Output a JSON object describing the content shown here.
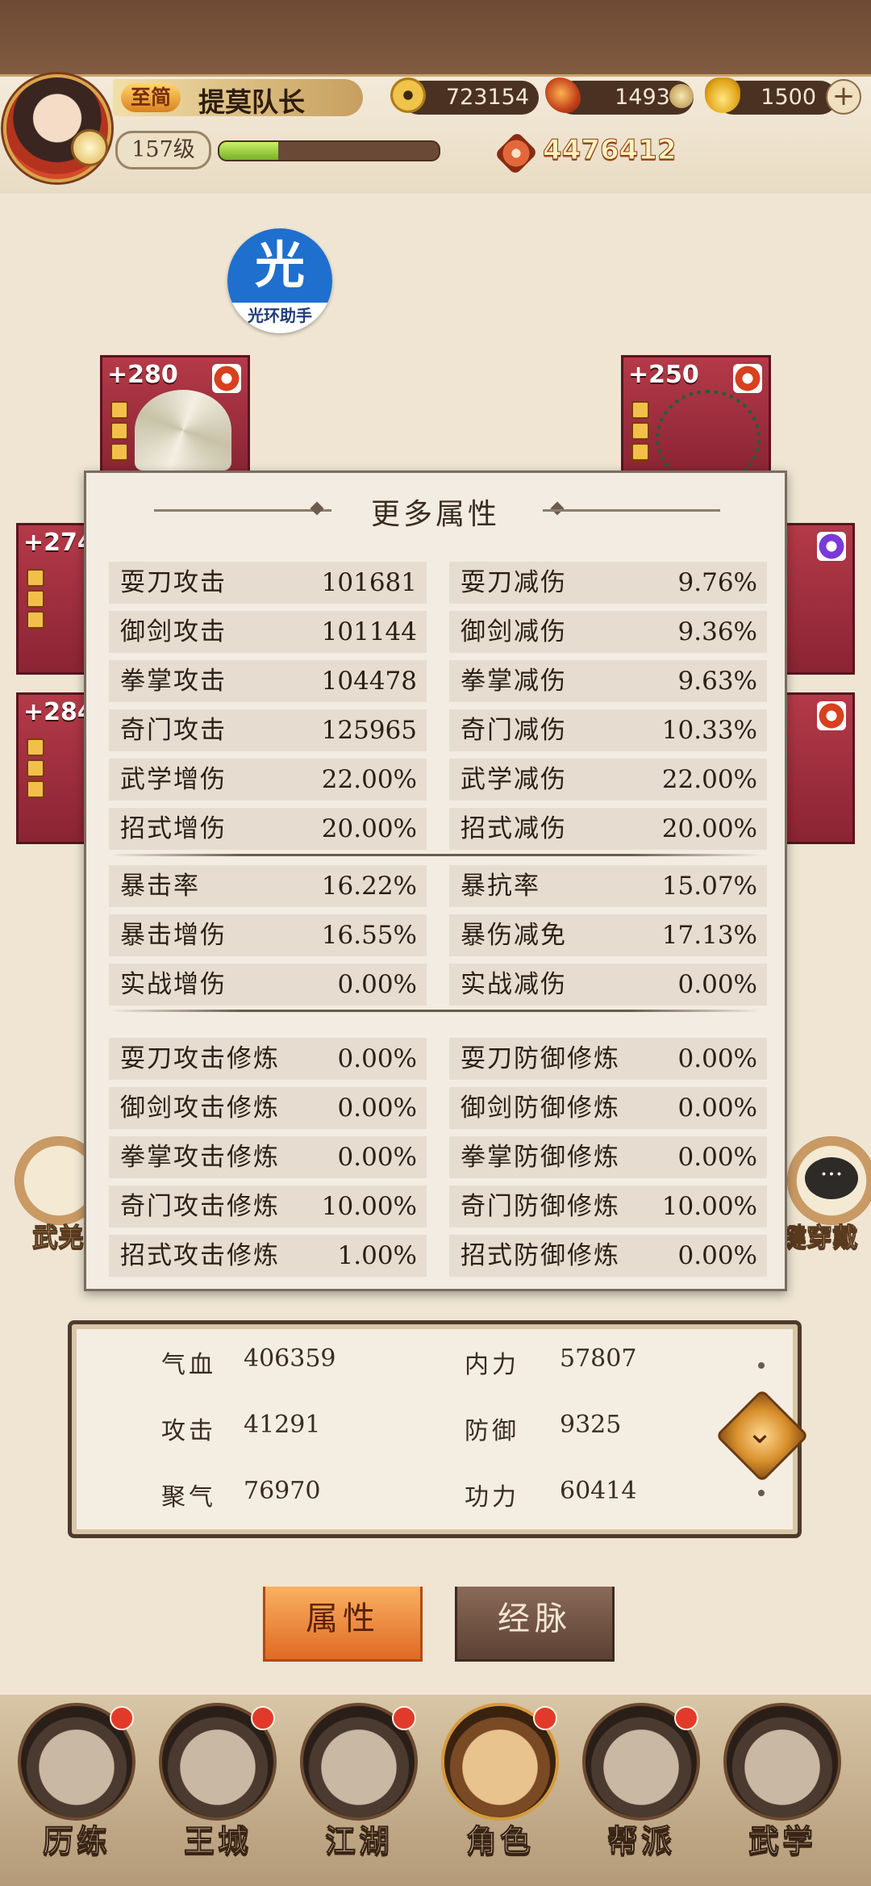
{
  "header": {
    "vip_label": "至简",
    "player_name": "提莫队长",
    "level": "157级",
    "xp_progress": 0.27,
    "resources": [
      {
        "name": "copper",
        "icon": "coin-icon",
        "value": "723154"
      },
      {
        "name": "leaf",
        "icon": "leaf-icon",
        "value": "14939"
      },
      {
        "name": "ingot",
        "icon": "ingot-icon",
        "value": "1500"
      }
    ],
    "power": "4476412"
  },
  "helper": {
    "glyph": "光",
    "label": "光环助手"
  },
  "equipment": [
    {
      "slot": "fan",
      "bonus": "+280"
    },
    {
      "slot": "beads",
      "bonus": "+250"
    },
    {
      "slot": "left-mid",
      "bonus": "+274"
    },
    {
      "slot": "left-low",
      "bonus": "+284"
    }
  ],
  "side_buttons": {
    "left_label": "武羌",
    "right_label": "键穿戴"
  },
  "more_attributes": {
    "title": "更多属性",
    "group1": [
      {
        "label": "耍刀攻击",
        "value": "101681",
        "label2": "耍刀减伤",
        "value2": "9.76%"
      },
      {
        "label": "御剑攻击",
        "value": "101144",
        "label2": "御剑减伤",
        "value2": "9.36%"
      },
      {
        "label": "拳掌攻击",
        "value": "104478",
        "label2": "拳掌减伤",
        "value2": "9.63%"
      },
      {
        "label": "奇门攻击",
        "value": "125965",
        "label2": "奇门减伤",
        "value2": "10.33%"
      },
      {
        "label": "武学增伤",
        "value": "22.00%",
        "label2": "武学减伤",
        "value2": "22.00%"
      },
      {
        "label": "招式增伤",
        "value": "20.00%",
        "label2": "招式减伤",
        "value2": "20.00%"
      }
    ],
    "group2": [
      {
        "label": "暴击率",
        "value": "16.22%",
        "label2": "暴抗率",
        "value2": "15.07%"
      },
      {
        "label": "暴击增伤",
        "value": "16.55%",
        "label2": "暴伤减免",
        "value2": "17.13%"
      },
      {
        "label": "实战增伤",
        "value": "0.00%",
        "label2": "实战减伤",
        "value2": "0.00%"
      }
    ],
    "group3": [
      {
        "label": "耍刀攻击修炼",
        "value": "0.00%",
        "label2": "耍刀防御修炼",
        "value2": "0.00%"
      },
      {
        "label": "御剑攻击修炼",
        "value": "0.00%",
        "label2": "御剑防御修炼",
        "value2": "0.00%"
      },
      {
        "label": "拳掌攻击修炼",
        "value": "0.00%",
        "label2": "拳掌防御修炼",
        "value2": "0.00%"
      },
      {
        "label": "奇门攻击修炼",
        "value": "10.00%",
        "label2": "奇门防御修炼",
        "value2": "10.00%"
      },
      {
        "label": "招式攻击修炼",
        "value": "1.00%",
        "label2": "招式防御修炼",
        "value2": "0.00%"
      }
    ]
  },
  "base_stats": [
    {
      "label": "气血",
      "value": "406359",
      "label2": "内力",
      "value2": "57807"
    },
    {
      "label": "攻击",
      "value": "41291",
      "label2": "防御",
      "value2": "9325"
    },
    {
      "label": "聚气",
      "value": "76970",
      "label2": "功力",
      "value2": "60414"
    }
  ],
  "sub_tabs": {
    "active": "属性",
    "inactive": "经脉"
  },
  "bottom_nav": [
    {
      "label": "历练",
      "badge": true
    },
    {
      "label": "王城",
      "badge": true
    },
    {
      "label": "江湖",
      "badge": true
    },
    {
      "label": "角色",
      "badge": true,
      "selected": true
    },
    {
      "label": "帮派",
      "badge": true
    },
    {
      "label": "武学",
      "badge": false
    }
  ]
}
